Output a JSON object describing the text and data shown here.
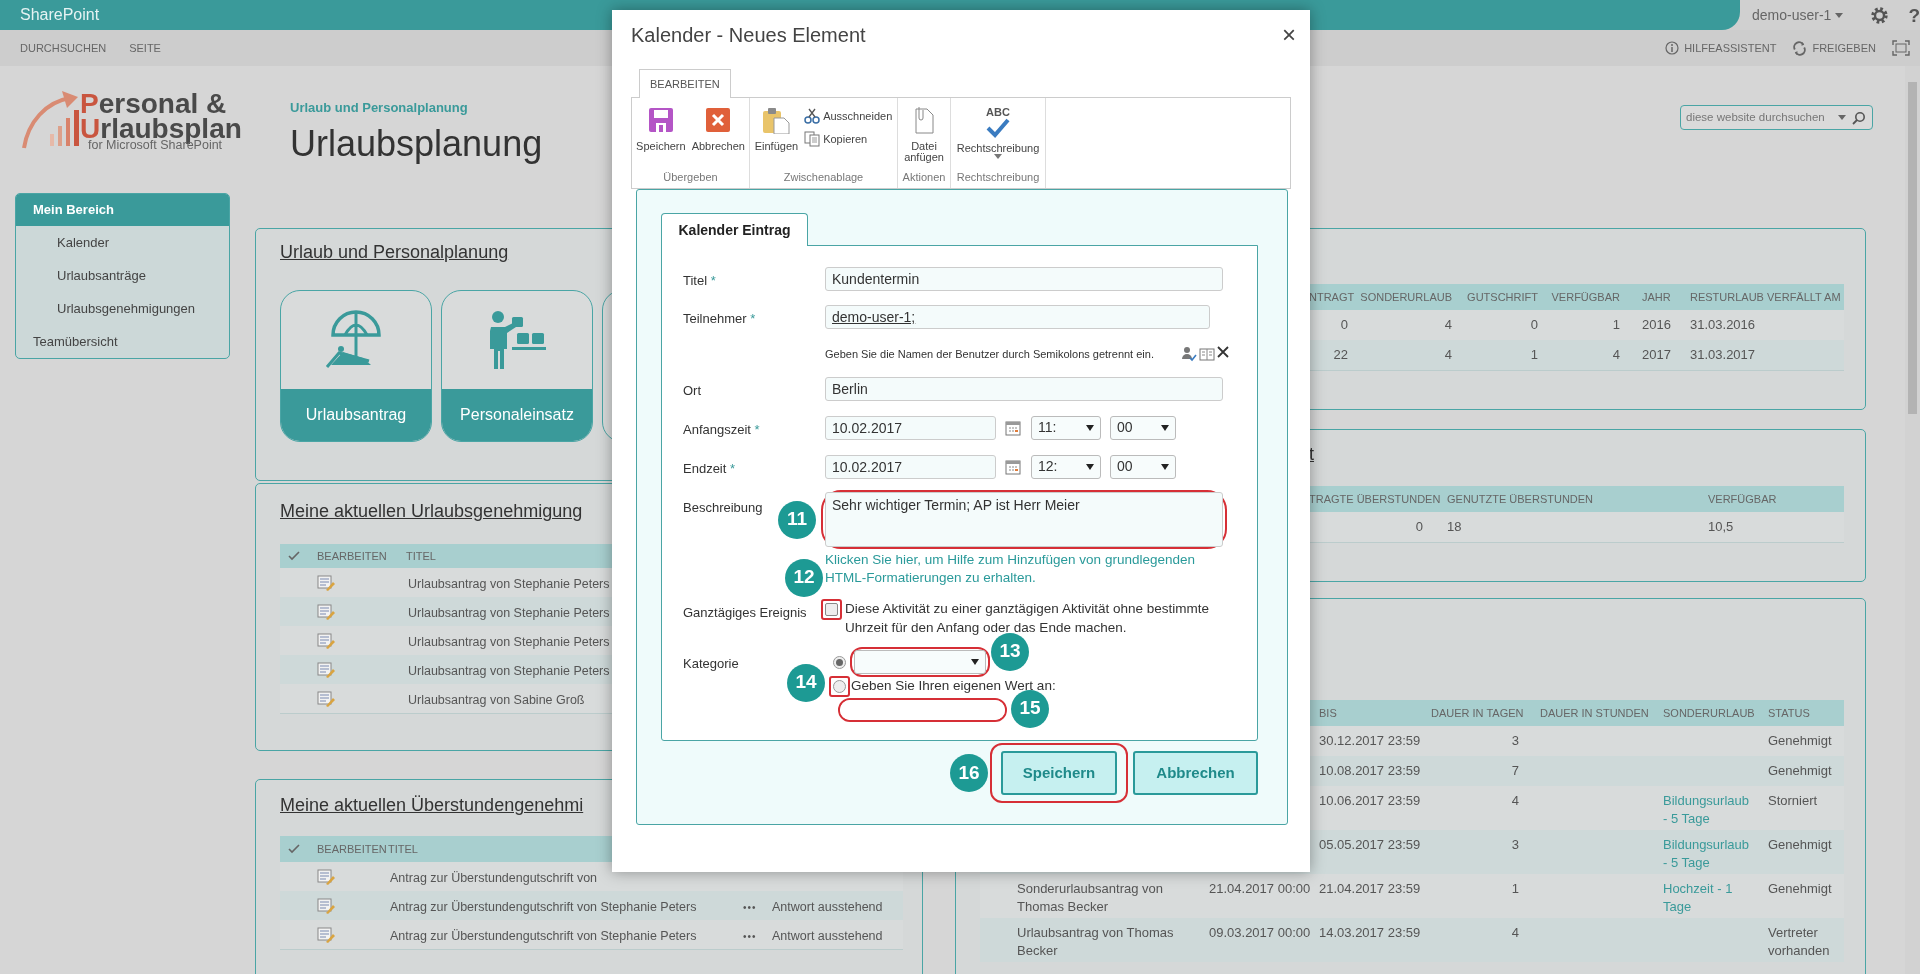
{
  "suite_bar": {
    "app": "SharePoint",
    "user": "demo-user-1",
    "help": "?"
  },
  "command_bar": {
    "left": [
      "DURCHSUCHEN",
      "SEITE"
    ],
    "right": [
      {
        "label": "HILFEASSISTENT",
        "kind": "info"
      },
      {
        "label": "FREIGEBEN",
        "kind": "share"
      }
    ]
  },
  "site": {
    "logo_line_1": "Personal &",
    "logo_line_2": "Urlaubsplan",
    "logo_line_3": "for Microsoft SharePoint",
    "breadcrumb": "Urlaub und Personalplanung",
    "title": "Urlaubsplanung",
    "search": {
      "placeholder": "diese website durchsuchen"
    }
  },
  "sidebar": {
    "items": [
      {
        "label": "Mein Bereich",
        "selected": true,
        "children": [
          {
            "label": "Kalender",
            "selected": false
          },
          {
            "label": "Urlaubsanträge",
            "selected": false
          },
          {
            "label": "Urlaubsgenehmigungen",
            "selected": false
          }
        ]
      },
      {
        "label": "Teamübersicht",
        "selected": false
      }
    ]
  },
  "planning_panel": {
    "heading": "Urlaub und Personalplanung",
    "tiles": [
      {
        "label": "Urlaubsantrag",
        "kind": "beach"
      },
      {
        "label": "Personaleinsatz",
        "kind": "staff"
      }
    ]
  },
  "vacation_approvals": {
    "heading": "Meine aktuellen Urlaubsgenehmigung",
    "columns": [
      "BEARBEITEN",
      "TITEL"
    ],
    "rows": [
      {
        "title": "Urlaubsantrag von Stephanie Peters"
      },
      {
        "title": "Urlaubsantrag von Stephanie Peters"
      },
      {
        "title": "Urlaubsantrag von Stephanie Peters"
      },
      {
        "title": "Urlaubsantrag von Stephanie Peters"
      },
      {
        "title": "Urlaubsantrag von Sabine Groß"
      }
    ]
  },
  "overtime_approvals": {
    "heading": "Meine aktuellen Überstundengenehmi",
    "columns": [
      "BEARBEITEN",
      "TITEL"
    ],
    "rows": [
      {
        "title": "Antrag zur Überstundengutschrift von"
      },
      {
        "title": "Antrag zur Überstundengutschrift von Stephanie Peters",
        "more": "•••",
        "status": "Antwort ausstehend"
      },
      {
        "title": "Antrag zur Überstundengutschrift von Stephanie Peters",
        "more": "•••",
        "status": "Antwort ausstehend"
      }
    ]
  },
  "balance_panel": {
    "columns": [
      "NTRAGT",
      "SONDERURLAUB",
      "GUTSCHRIFT",
      "VERFÜGBAR",
      "JAHR",
      "RESTURLAUB VERFÄLLT AM"
    ],
    "rows": [
      [
        "0",
        "4",
        "0",
        "1",
        "2016",
        "31.03.2016"
      ],
      [
        "22",
        "4",
        "1",
        "4",
        "2017",
        "31.03.2017"
      ]
    ]
  },
  "overtime_panel": {
    "heading": "t",
    "columns": [
      "TRAGTE ÜBERSTUNDEN",
      "GENUTZTE ÜBERSTUNDEN",
      "VERFÜGBAR"
    ],
    "rows": [
      [
        "0",
        "18",
        "10,5"
      ]
    ]
  },
  "requests_panel": {
    "columns": [
      "BIS",
      "DAUER IN TAGEN",
      "DAUER IN STUNDEN",
      "SONDERURLAUB",
      "STATUS"
    ],
    "rows": [
      {
        "bis": "30.12.2017 23:59",
        "days": "3",
        "status": "Genehmigt"
      },
      {
        "bis": "10.08.2017 23:59",
        "days": "7",
        "status": "Genehmigt"
      },
      {
        "bis": "10.06.2017 23:59",
        "days": "4",
        "special": "Bildungsurlaub - 5 Tage",
        "status": "Storniert"
      },
      {
        "bis": "05.05.2017 23:59",
        "days": "3",
        "special": "Bildungsurlaub - 5 Tage",
        "status": "Genehmigt"
      },
      {
        "title": "Sonderurlaubsantrag von Thomas Becker",
        "von": "21.04.2017 00:00",
        "bis": "21.04.2017 23:59",
        "days": "1",
        "special": "Hochzeit - 1 Tage",
        "status": "Genehmigt"
      },
      {
        "title": "Urlaubsantrag von Thomas Becker",
        "von": "09.03.2017 00:00",
        "bis": "14.03.2017 23:59",
        "days": "4",
        "status": "Vertreter vorhanden"
      }
    ]
  },
  "dialog": {
    "title": "Kalender - Neues Element",
    "close": "×",
    "ribbon_tabs": [
      {
        "label": "BEARBEITEN",
        "selected": true
      }
    ],
    "ribbon_groups": [
      {
        "label": "Übergeben",
        "commands": [
          {
            "label": "Speichern",
            "kind": "save"
          },
          {
            "label": "Abbrechen",
            "kind": "cancel"
          }
        ]
      },
      {
        "label": "Zwischenablage",
        "commands": [
          {
            "label": "Einfügen",
            "kind": "paste"
          },
          {
            "label": "Ausschneiden",
            "kind": "cut"
          },
          {
            "label": "Kopieren",
            "kind": "copy"
          }
        ]
      },
      {
        "label": "Aktionen",
        "commands": [
          {
            "label": "Datei anfügen",
            "kind": "attach"
          }
        ]
      },
      {
        "label": "Rechtschreibung",
        "commands": [
          {
            "label": "Rechtschreibung",
            "kind": "spelling",
            "icon_text": "ABC"
          }
        ]
      }
    ],
    "form_tabs": [
      {
        "label": "Kalender Eintrag",
        "selected": true
      }
    ],
    "fields": [
      {
        "kind": "text",
        "label": "Titel",
        "mark": "*",
        "value": "Kundentermin"
      },
      {
        "kind": "people",
        "label": "Teilnehmer",
        "mark": "*",
        "value": "demo-user-1;",
        "hint": "Geben Sie die Namen der Benutzer durch Semikolons getrennt ein."
      },
      {
        "kind": "text",
        "label": "Ort",
        "value": "Berlin"
      },
      {
        "kind": "datetime",
        "label": "Anfangszeit",
        "mark": "*",
        "date": "10.02.2017",
        "hour": "11:",
        "minute": "00"
      },
      {
        "kind": "datetime",
        "label": "Endzeit",
        "mark": "*",
        "date": "10.02.2017",
        "hour": "12:",
        "minute": "00"
      },
      {
        "kind": "textarea",
        "label": "Beschreibung",
        "value": "Sehr wichtiger Termin; AP ist Herr Meier",
        "help": "Klicken Sie hier, um Hilfe zum Hinzufügen von grundlegenden HTML-Formatierungen zu erhalten.",
        "callout": "11"
      },
      {
        "kind": "checkbox",
        "label": "Ganztägiges Ereignis",
        "checked": false,
        "text": "Diese Aktivität zu einer ganztägigen Aktivität ohne bestimmte Uhrzeit für den Anfang oder das Ende machen.",
        "callout": "12"
      },
      {
        "kind": "choice",
        "label": "Kategorie",
        "options": [
          {
            "kind": "dropdown",
            "selected": true,
            "callout": "13"
          },
          {
            "kind": "custom",
            "selected": false,
            "text": "Geben Sie Ihren eigenen Wert an:",
            "callout": "14",
            "input_callout": "15"
          }
        ]
      }
    ],
    "buttons": [
      {
        "label": "Speichern",
        "callout": "16"
      },
      {
        "label": "Abbrechen"
      }
    ]
  }
}
